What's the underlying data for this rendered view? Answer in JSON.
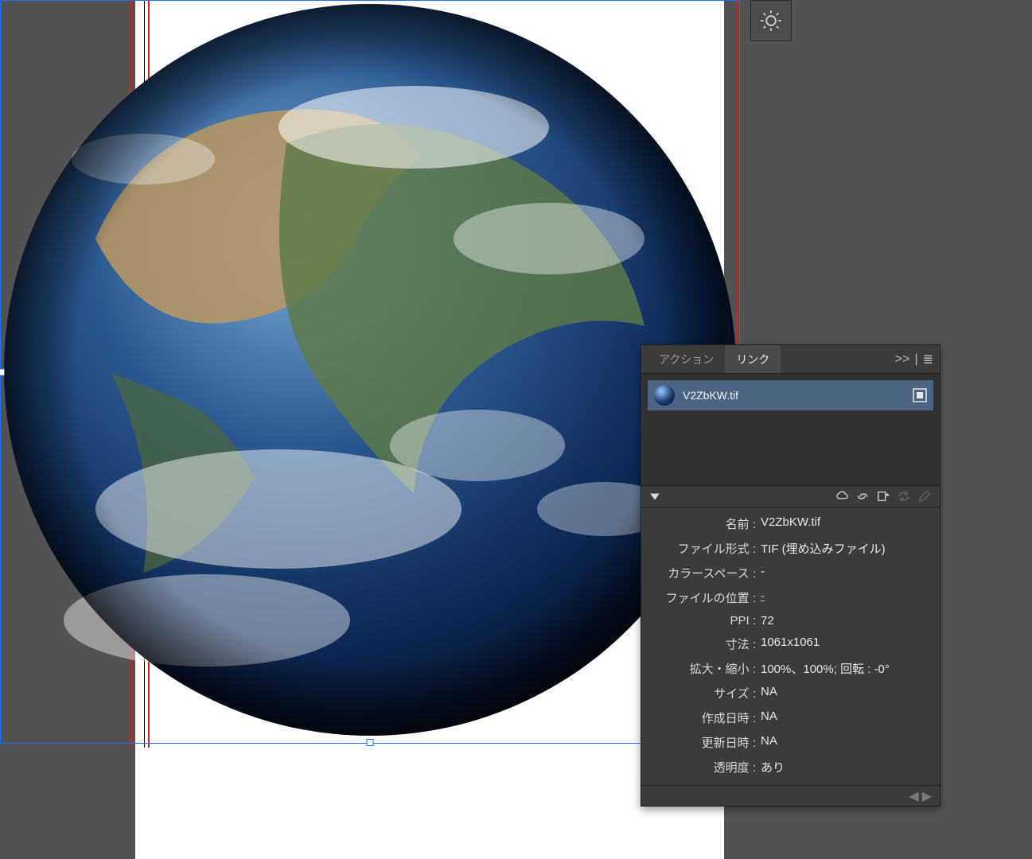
{
  "tabs": {
    "action_label": "アクション",
    "link_label": "リンク"
  },
  "panel_menu": {
    "collapse_glyph": ">>",
    "menu_glyph": "≣"
  },
  "link_item": {
    "filename": "V2ZbKW.tif"
  },
  "details": {
    "name_label": "名前 :",
    "name_value": "V2ZbKW.tif",
    "format_label": "ファイル形式 :",
    "format_value": "TIF (埋め込みファイル)",
    "colorspace_label": "カラースペース :",
    "colorspace_value": "-",
    "location_label": "ファイルの位置 :",
    "location_value": "-",
    "ppi_label": "PPI :",
    "ppi_value": "72",
    "dimensions_label": "寸法 :",
    "dimensions_value": "1061x1061",
    "scale_label": "拡大・縮小 :",
    "scale_value": "100%、100%; 回転 : -0°",
    "size_label": "サイズ :",
    "size_value": "NA",
    "created_label": "作成日時 :",
    "created_value": "NA",
    "modified_label": "更新日時 :",
    "modified_value": "NA",
    "transparency_label": "透明度 :",
    "transparency_value": "あり"
  }
}
